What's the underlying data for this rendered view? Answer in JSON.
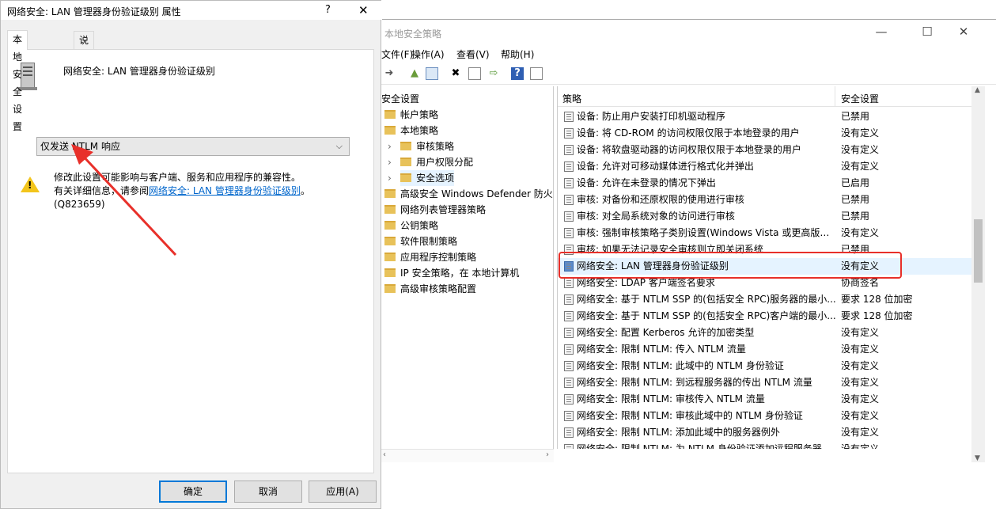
{
  "main_window": {
    "title": "本地安全策略",
    "menu": [
      "文件(F)",
      "操作(A)",
      "查看(V)",
      "帮助(H)"
    ],
    "tree": [
      {
        "label": "安全设置",
        "level": 0
      },
      {
        "label": "帐户策略",
        "level": 1
      },
      {
        "label": "本地策略",
        "level": 1
      },
      {
        "label": "审核策略",
        "level": 2
      },
      {
        "label": "用户权限分配",
        "level": 2
      },
      {
        "label": "安全选项",
        "level": 2
      },
      {
        "label": "高级安全 Windows Defender 防火墙",
        "level": 1
      },
      {
        "label": "网络列表管理器策略",
        "level": 1
      },
      {
        "label": "公钥策略",
        "level": 1
      },
      {
        "label": "软件限制策略",
        "level": 1
      },
      {
        "label": "应用程序控制策略",
        "level": 1
      },
      {
        "label": "IP 安全策略，在 本地计算机",
        "level": 1
      },
      {
        "label": "高级审核策略配置",
        "level": 1
      }
    ],
    "columns": {
      "policy": "策略",
      "setting": "安全设置"
    },
    "rows": [
      {
        "policy": "设备: 防止用户安装打印机驱动程序",
        "setting": "已禁用"
      },
      {
        "policy": "设备: 将 CD-ROM 的访问权限仅限于本地登录的用户",
        "setting": "没有定义"
      },
      {
        "policy": "设备: 将软盘驱动器的访问权限仅限于本地登录的用户",
        "setting": "没有定义"
      },
      {
        "policy": "设备: 允许对可移动媒体进行格式化并弹出",
        "setting": "没有定义"
      },
      {
        "policy": "设备: 允许在未登录的情况下弹出",
        "setting": "已启用"
      },
      {
        "policy": "审核: 对备份和还原权限的使用进行审核",
        "setting": "已禁用"
      },
      {
        "policy": "审核: 对全局系统对象的访问进行审核",
        "setting": "已禁用"
      },
      {
        "policy": "审核: 强制审核策略子类别设置(Windows Vista 或更高版本...",
        "setting": "没有定义"
      },
      {
        "policy": "审核: 如果无法记录安全审核则立即关闭系统",
        "setting": "已禁用"
      },
      {
        "policy": "网络安全: LAN 管理器身份验证级别",
        "setting": "没有定义"
      },
      {
        "policy": "网络安全: LDAP 客户端签名要求",
        "setting": "协商签名"
      },
      {
        "policy": "网络安全: 基于 NTLM SSP 的(包括安全 RPC)服务器的最小...",
        "setting": "要求 128 位加密"
      },
      {
        "policy": "网络安全: 基于 NTLM SSP 的(包括安全 RPC)客户端的最小...",
        "setting": "要求 128 位加密"
      },
      {
        "policy": "网络安全: 配置 Kerberos 允许的加密类型",
        "setting": "没有定义"
      },
      {
        "policy": "网络安全: 限制 NTLM: 传入 NTLM 流量",
        "setting": "没有定义"
      },
      {
        "policy": "网络安全: 限制 NTLM: 此域中的 NTLM 身份验证",
        "setting": "没有定义"
      },
      {
        "policy": "网络安全: 限制 NTLM: 到远程服务器的传出 NTLM 流量",
        "setting": "没有定义"
      },
      {
        "policy": "网络安全: 限制 NTLM: 审核传入 NTLM 流量",
        "setting": "没有定义"
      },
      {
        "policy": "网络安全: 限制 NTLM: 审核此域中的 NTLM 身份验证",
        "setting": "没有定义"
      },
      {
        "policy": "网络安全: 限制 NTLM: 添加此域中的服务器例外",
        "setting": "没有定义"
      },
      {
        "policy": "网络安全: 限制 NTLM: 为 NTLM 身份验证添加远程服务器...",
        "setting": "没有定义"
      }
    ]
  },
  "dialog": {
    "title": "网络安全: LAN 管理器身份验证级别 属性",
    "help": "?",
    "close": "✕",
    "tabs": [
      "本地安全设置",
      "说明"
    ],
    "policy_name": "网络安全: LAN 管理器身份验证级别",
    "selected_option": "仅发送 NTLM 响应",
    "warning_line1": "修改此设置可能影响与客户端、服务和应用程序的兼容性。",
    "warning_prefix": "有关详细信息，请参阅",
    "warning_link": "网络安全: LAN 管理器身份验证级别",
    "warning_suffix": "。",
    "warning_kb": "(Q823659)",
    "buttons": {
      "ok": "确定",
      "cancel": "取消",
      "apply": "应用(A)"
    }
  },
  "colors": {
    "highlight": "#e8302a",
    "selection": "#e5f3ff",
    "link": "#0066cc",
    "default_button": "#0078d7"
  }
}
